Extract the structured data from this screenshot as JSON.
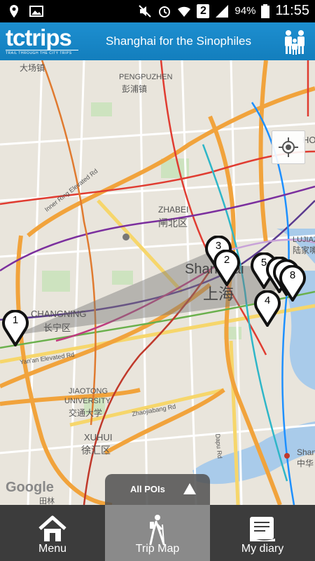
{
  "status_bar": {
    "battery": "94%",
    "time": "11:55",
    "notification_count": "2"
  },
  "header": {
    "logo_tc": "tc",
    "logo_trips": "trips",
    "logo_tagline": "TRAIL THROUGH THE CITY TRIPS",
    "title": "Shanghai for the Sinophiles"
  },
  "map": {
    "labels": {
      "dachang": "大场镇",
      "pengpuzhen": "PENGPUZHEN",
      "pengpuzhen_cn": "彭浦镇",
      "zhabei": "ZHABEI",
      "zhabei_cn": "闸北区",
      "shanghai": "Shanghai",
      "shanghai_cn": "上海",
      "changning": "CHANGNING",
      "changning_cn": "长宁区",
      "lujiaz": "LUJIAZ",
      "lujiaz_cn": "陆家嘴",
      "ho": "HO",
      "jiaotong1": "JIAOTONG",
      "jiaotong2": "UNIVERSITY",
      "jiaotong_cn": "交通大学",
      "xuhui": "XUHUI",
      "xuhui_cn": "徐汇区",
      "inner_ring": "Inner Ring Elevated Rd",
      "yanan": "Yan'an Elevated Rd",
      "zhaojiabang": "Zhaojiabang Rd",
      "dapu": "Dapu Rd",
      "shan": "Shan",
      "zhonghua": "中华",
      "tianlin": "田林",
      "google": "Google"
    },
    "pins": [
      "1",
      "2",
      "3",
      "4",
      "5",
      "8"
    ]
  },
  "poi_selector": {
    "label": "All POIs"
  },
  "bottom_nav": {
    "menu": "Menu",
    "trip_map": "Trip Map",
    "my_diary": "My diary"
  }
}
